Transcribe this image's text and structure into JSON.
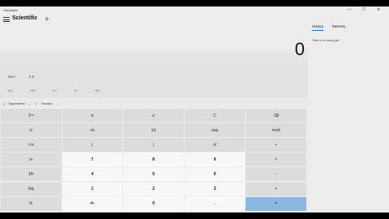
{
  "window": {
    "title": "Calculator",
    "minimize": "—",
    "maximize": "☐",
    "close": "✕"
  },
  "header": {
    "mode": "Scientific",
    "keep_on_top": "⧉"
  },
  "display": {
    "value": "0"
  },
  "angle_row": [
    "DEG",
    "F-E"
  ],
  "memory_row": [
    "MC",
    "MR",
    "M+",
    "M-",
    "MS"
  ],
  "toolbar": {
    "trig": "Trigonometry",
    "func": "Function"
  },
  "keypad": {
    "rows": [
      [
        "2ⁿᵈ",
        "π",
        "e",
        "C",
        "⌫"
      ],
      [
        "x²",
        "¹/x",
        "|x|",
        "exp",
        "mod"
      ],
      [
        "²√x",
        "(",
        ")",
        "n!",
        "÷"
      ],
      [
        "xʸ",
        "7",
        "8",
        "9",
        "×"
      ],
      [
        "10ˣ",
        "4",
        "5",
        "6",
        "−"
      ],
      [
        "log",
        "1",
        "2",
        "3",
        "+"
      ],
      [
        "ln",
        "+/-",
        "0",
        ".",
        "="
      ]
    ]
  },
  "history": {
    "tab_history": "History",
    "tab_memory": "Memory",
    "empty_text": "There's no history yet"
  },
  "colors": {
    "accent": "#1a73c8",
    "equals_key": "#8bb8e0"
  }
}
